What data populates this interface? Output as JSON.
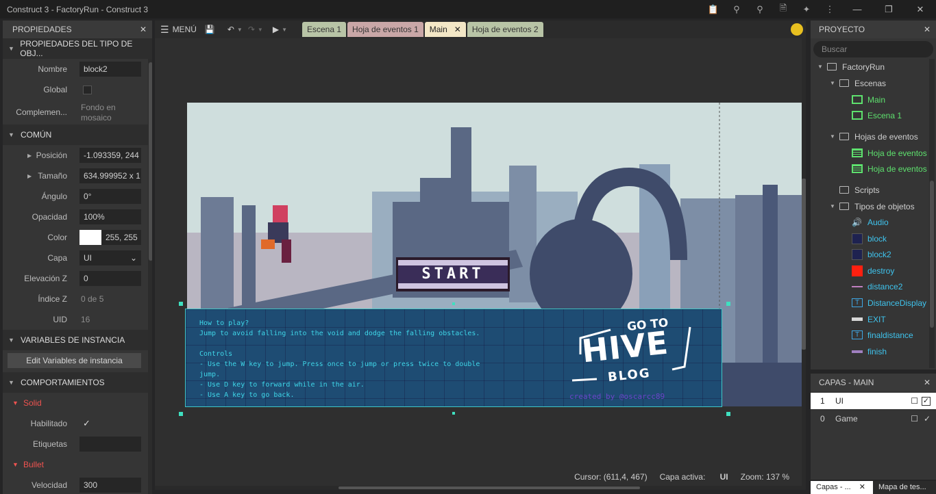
{
  "window": {
    "title": "Construct 3 - FactoryRun - Construct 3"
  },
  "properties": {
    "title": "PROPIEDADES",
    "section_type": "PROPIEDADES DEL TIPO DE OBJ...",
    "name_label": "Nombre",
    "name_value": "block2",
    "global_label": "Global",
    "plugin_label": "Complemen...",
    "plugin_value_1": "Fondo en",
    "plugin_value_2": "mosaico",
    "section_common": "COMÚN",
    "position_label": "Posición",
    "position_value": "-1.093359, 244",
    "size_label": "Tamaño",
    "size_value": "634.999952 x 1",
    "angle_label": "Ángulo",
    "angle_value": "0°",
    "opacity_label": "Opacidad",
    "opacity_value": "100%",
    "color_label": "Color",
    "color_value": "255, 255",
    "layer_label": "Capa",
    "layer_value": "UI",
    "zelev_label": "Elevación Z",
    "zelev_value": "0",
    "zindex_label": "Índice Z",
    "zindex_value": "0 de 5",
    "uid_label": "UID",
    "uid_value": "16",
    "section_vars": "VARIABLES DE INSTANCIA",
    "edit_vars_button": "Edit Variables de instancia",
    "section_behaviors": "COMPORTAMIENTOS",
    "behavior_solid": "Solid",
    "enabled_label": "Habilitado",
    "tags_label": "Etiquetas",
    "behavior_bullet": "Bullet",
    "speed_label": "Velocidad",
    "speed_value": "300"
  },
  "toolbar": {
    "menu_label": "MENÚ",
    "tabs": [
      {
        "label": "Escena 1",
        "color": "#b8c4a6"
      },
      {
        "label": "Hoja de eventos 1",
        "color": "#c9a7a7"
      },
      {
        "label": "Main",
        "color": "#f3e7c6"
      },
      {
        "label": "Hoja de eventos 2",
        "color": "#b8c4a6"
      }
    ]
  },
  "layout": {
    "start_label": "START",
    "hive_go_to": "GO TO",
    "hive_word": "HIVE",
    "hive_blog": "BLOG",
    "credit": "created by @oscarcc89",
    "hud_text": "How to play?\nJump to avoid falling into the void and dodge the falling obstacles.\n\nControls\n- Use the W key to jump. Press once to jump or press twice to double\njump.\n- Use D key to forward while in the air.\n- Use A key to go back.",
    "status_cursor": "Cursor: (611,4, 467)",
    "status_layer_prefix": "Capa activa:",
    "status_layer": "UI",
    "status_zoom": "Zoom: 137 %"
  },
  "project": {
    "title": "PROYECTO",
    "search_placeholder": "Buscar",
    "root": "FactoryRun",
    "scenes_folder": "Escenas",
    "scenes": [
      "Main",
      "Escena 1"
    ],
    "sheets_folder": "Hojas de eventos",
    "sheets": [
      "Hoja de eventos",
      "Hoja de eventos"
    ],
    "scripts_folder": "Scripts",
    "types_folder": "Tipos de objetos",
    "types": [
      "Audio",
      "block",
      "block2",
      "destroy",
      "distance2",
      "DistanceDisplay",
      "EXIT",
      "finaldistance",
      "finish"
    ]
  },
  "layers": {
    "title": "CAPAS - MAIN",
    "items": [
      {
        "index": "1",
        "name": "UI"
      },
      {
        "index": "0",
        "name": "Game"
      }
    ]
  },
  "bottom_tabs": {
    "layers_tab": "Capas - ...",
    "map_tab": "Mapa de tes..."
  }
}
